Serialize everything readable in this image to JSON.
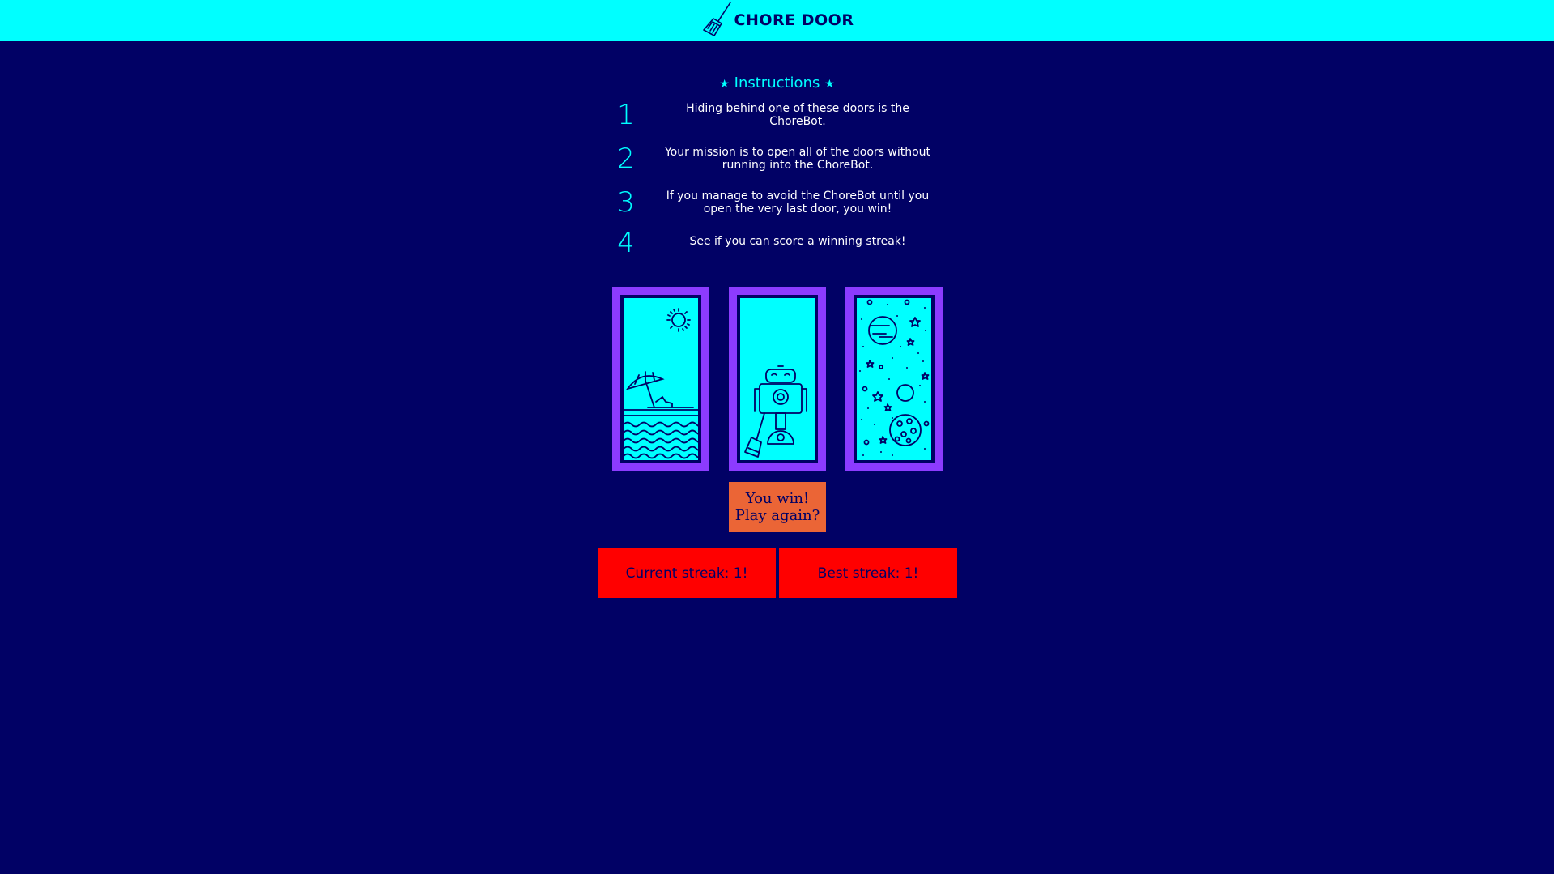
{
  "header": {
    "title": "CHORE DOOR",
    "logo_icon": "broom-icon"
  },
  "instructions": {
    "title": "Instructions",
    "star_glyph": "★",
    "items": [
      {
        "number": "1",
        "text": "Hiding behind one of these doors is the ChoreBot."
      },
      {
        "number": "2",
        "text": "Your mission is to open all of the doors without running into the ChoreBot."
      },
      {
        "number": "3",
        "text": "If you manage to avoid the ChoreBot until you open the very last door, you win!"
      },
      {
        "number": "4",
        "text": "See if you can score a winning streak!"
      }
    ]
  },
  "doors": [
    {
      "image": "beach-icon"
    },
    {
      "image": "robot-icon"
    },
    {
      "image": "space-icon"
    }
  ],
  "game": {
    "start_button_label": "You win! Play again?"
  },
  "score": {
    "current_streak": "Current streak: 1!",
    "best_streak": "Best streak: 1!"
  },
  "colors": {
    "background": "#010165",
    "header": "#00ffff",
    "door_frame": "#8c3bff",
    "start_button": "#eb6536",
    "streak": "#ff0000"
  }
}
